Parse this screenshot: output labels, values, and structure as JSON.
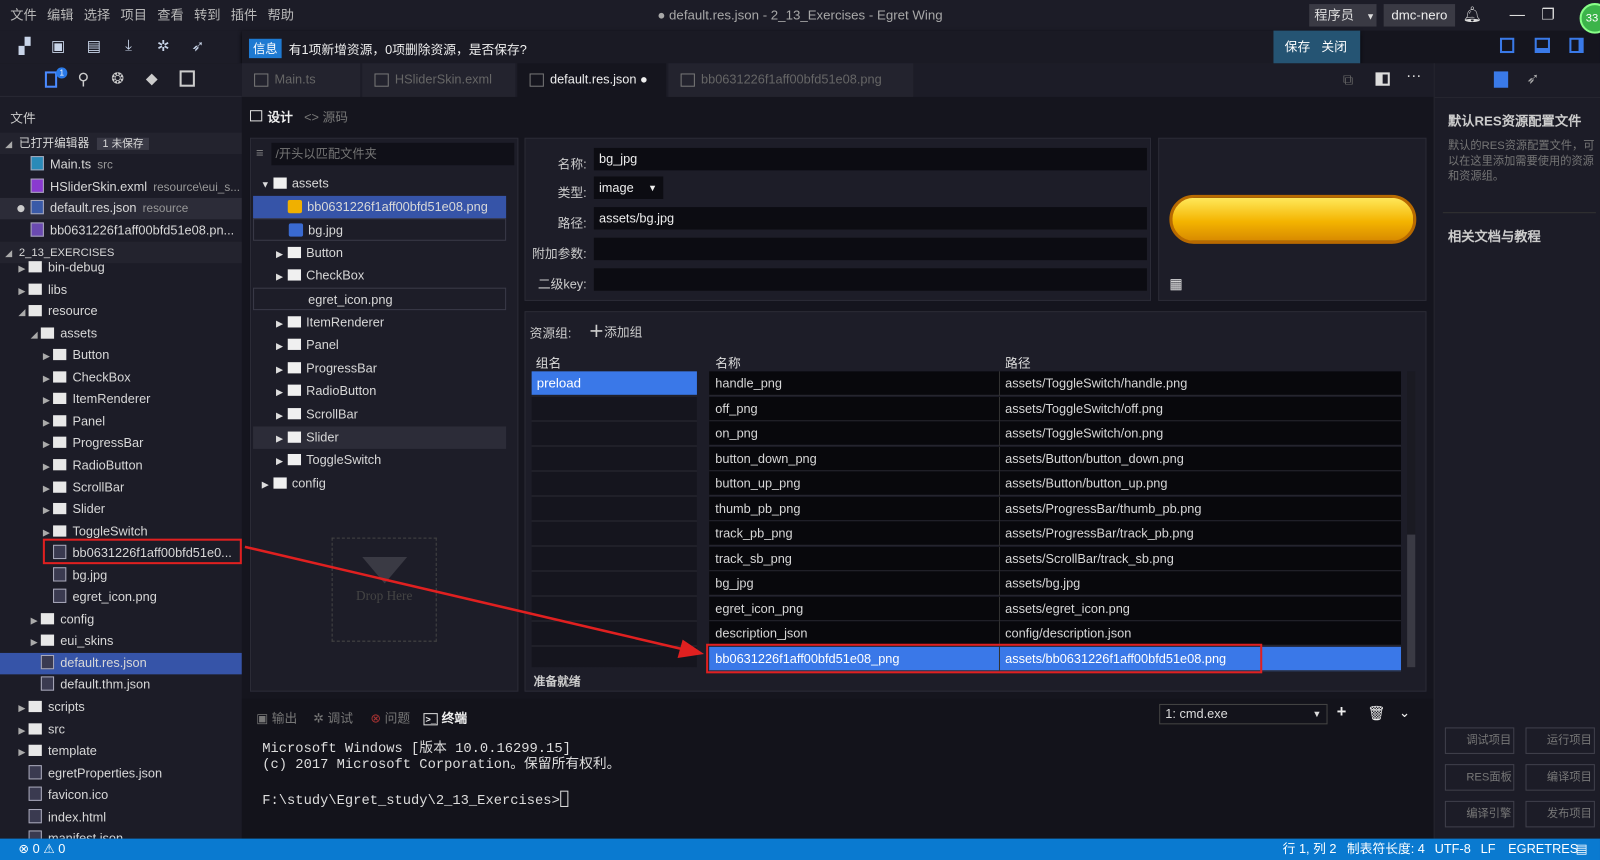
{
  "menu": [
    "文件",
    "编辑",
    "选择",
    "项目",
    "查看",
    "转到",
    "插件",
    "帮助"
  ],
  "window_title": "● default.res.json - 2_13_Exercises - Egret Wing",
  "role": "程序员",
  "user": "dmc-nero",
  "avatar_badge": "33",
  "notice": {
    "tag": "信息",
    "message": "有1项新增资源，0项删除资源，是否保存?",
    "save": "保存",
    "close": "关闭"
  },
  "activity_badge": "1",
  "sidebar": {
    "header": "文件",
    "open_editors_label": "已打开编辑器",
    "unsaved_badge": "1 未保存",
    "open_editors": [
      {
        "name": "Main.ts",
        "sub": "src",
        "icon": "TS"
      },
      {
        "name": "HSliderSkin.exml",
        "sub": "resource\\eui_s...",
        "icon": "EX"
      },
      {
        "name": "default.res.json",
        "sub": "resource",
        "icon": "JS",
        "modified": true
      },
      {
        "name": "bb0631226f1aff00bfd51e08.pn...",
        "sub": "",
        "icon": "PNG"
      }
    ],
    "project_label": "2_13_EXERCISES",
    "tree": [
      {
        "name": "bin-debug",
        "d": 0,
        "t": "folder"
      },
      {
        "name": "libs",
        "d": 0,
        "t": "folder"
      },
      {
        "name": "resource",
        "d": 0,
        "t": "open"
      },
      {
        "name": "assets",
        "d": 1,
        "t": "open"
      },
      {
        "name": "Button",
        "d": 2,
        "t": "folder"
      },
      {
        "name": "CheckBox",
        "d": 2,
        "t": "folder"
      },
      {
        "name": "ItemRenderer",
        "d": 2,
        "t": "folder"
      },
      {
        "name": "Panel",
        "d": 2,
        "t": "folder"
      },
      {
        "name": "ProgressBar",
        "d": 2,
        "t": "folder"
      },
      {
        "name": "RadioButton",
        "d": 2,
        "t": "folder"
      },
      {
        "name": "ScrollBar",
        "d": 2,
        "t": "folder"
      },
      {
        "name": "Slider",
        "d": 2,
        "t": "folder"
      },
      {
        "name": "ToggleSwitch",
        "d": 2,
        "t": "folder"
      },
      {
        "name": "bb0631226f1aff00bfd51e0...",
        "d": 2,
        "t": "file"
      },
      {
        "name": "bg.jpg",
        "d": 2,
        "t": "file"
      },
      {
        "name": "egret_icon.png",
        "d": 2,
        "t": "file"
      },
      {
        "name": "config",
        "d": 1,
        "t": "folder"
      },
      {
        "name": "eui_skins",
        "d": 1,
        "t": "folder"
      },
      {
        "name": "default.res.json",
        "d": 1,
        "t": "file",
        "selected": true
      },
      {
        "name": "default.thm.json",
        "d": 1,
        "t": "file"
      },
      {
        "name": "scripts",
        "d": 0,
        "t": "folder"
      },
      {
        "name": "src",
        "d": 0,
        "t": "folder"
      },
      {
        "name": "template",
        "d": 0,
        "t": "folder"
      },
      {
        "name": "egretProperties.json",
        "d": 0,
        "t": "file"
      },
      {
        "name": "favicon.ico",
        "d": 0,
        "t": "file"
      },
      {
        "name": "index.html",
        "d": 0,
        "t": "file"
      },
      {
        "name": "manifest.json",
        "d": 0,
        "t": "file"
      }
    ]
  },
  "tabs": [
    {
      "label": "Main.ts"
    },
    {
      "label": "HSliderSkin.exml"
    },
    {
      "label": "default.res.json ●"
    },
    {
      "label": "bb0631226f1aff00bfd51e08.png"
    }
  ],
  "view_toggle": {
    "design": "设计",
    "source": "<> 源码"
  },
  "asset_tree": {
    "filter_placeholder": "/开头以匹配文件夹",
    "items": [
      {
        "name": "assets",
        "t": "open",
        "d": 0
      },
      {
        "name": "bb0631226f1aff00bfd51e08.png",
        "t": "png",
        "d": 1,
        "selected": true
      },
      {
        "name": "bg.jpg",
        "t": "jpg",
        "d": 1
      },
      {
        "name": "Button",
        "t": "folder",
        "d": 1
      },
      {
        "name": "CheckBox",
        "t": "folder",
        "d": 1
      },
      {
        "name": "egret_icon.png",
        "t": "egret",
        "d": 1
      },
      {
        "name": "ItemRenderer",
        "t": "folder",
        "d": 1
      },
      {
        "name": "Panel",
        "t": "folder",
        "d": 1
      },
      {
        "name": "ProgressBar",
        "t": "folder",
        "d": 1
      },
      {
        "name": "RadioButton",
        "t": "folder",
        "d": 1
      },
      {
        "name": "ScrollBar",
        "t": "folder",
        "d": 1
      },
      {
        "name": "Slider",
        "t": "folder",
        "d": 1
      },
      {
        "name": "ToggleSwitch",
        "t": "folder",
        "d": 1
      },
      {
        "name": "config",
        "t": "folder",
        "d": 0
      }
    ],
    "drop_here": "Drop Here"
  },
  "props": {
    "name_label": "名称:",
    "name": "bg_jpg",
    "type_label": "类型:",
    "type": "image",
    "path_label": "路径:",
    "path": "assets/bg.jpg",
    "extra_label": "附加参数:",
    "extra": "",
    "subkey_label": "二级key:",
    "subkey": ""
  },
  "groups": {
    "label": "资源组:",
    "add": "添加组",
    "col_group": "组名",
    "col_name": "名称",
    "col_path": "路径",
    "group_list": [
      "preload"
    ],
    "status": "准备就绪",
    "rows": [
      [
        "handle_png",
        "assets/ToggleSwitch/handle.png"
      ],
      [
        "off_png",
        "assets/ToggleSwitch/off.png"
      ],
      [
        "on_png",
        "assets/ToggleSwitch/on.png"
      ],
      [
        "button_down_png",
        "assets/Button/button_down.png"
      ],
      [
        "button_up_png",
        "assets/Button/button_up.png"
      ],
      [
        "thumb_pb_png",
        "assets/ProgressBar/thumb_pb.png"
      ],
      [
        "track_pb_png",
        "assets/ProgressBar/track_pb.png"
      ],
      [
        "track_sb_png",
        "assets/ScrollBar/track_sb.png"
      ],
      [
        "bg_jpg",
        "assets/bg.jpg"
      ],
      [
        "egret_icon_png",
        "assets/egret_icon.png"
      ],
      [
        "description_json",
        "config/description.json"
      ],
      [
        "bb0631226f1aff00bfd51e08_png",
        "assets/bb0631226f1aff00bfd51e08.png"
      ]
    ]
  },
  "bottom": {
    "tabs": [
      "输出",
      "调试",
      "问题",
      "终端"
    ],
    "terminal_select": "1: cmd.exe",
    "terminal": "Microsoft Windows [版本 10.0.16299.15]\n(c) 2017 Microsoft Corporation。保留所有权利。\n\nF:\\study\\Egret_study\\2_13_Exercises>"
  },
  "right_panel": {
    "title": "默认RES资源配置文件",
    "desc": "默认的RES资源配置文件，可以在这里添加需要使用的资源和资源组。",
    "docs": "相关文档与教程",
    "buttons": [
      "调试项目",
      "运行项目",
      "RES面板",
      "编译项目",
      "编译引擎",
      "发布项目"
    ]
  },
  "status": {
    "errors": "0",
    "warnings": "0",
    "position": "行 1, 列 2",
    "tab_size": "制表符长度: 4",
    "encoding": "UTF-8",
    "eol": "LF",
    "language": "EGRETRES"
  },
  "colors": {
    "accent": "#0a7ad0",
    "selection": "#3a78e8",
    "highlight_box": "#e02020"
  }
}
